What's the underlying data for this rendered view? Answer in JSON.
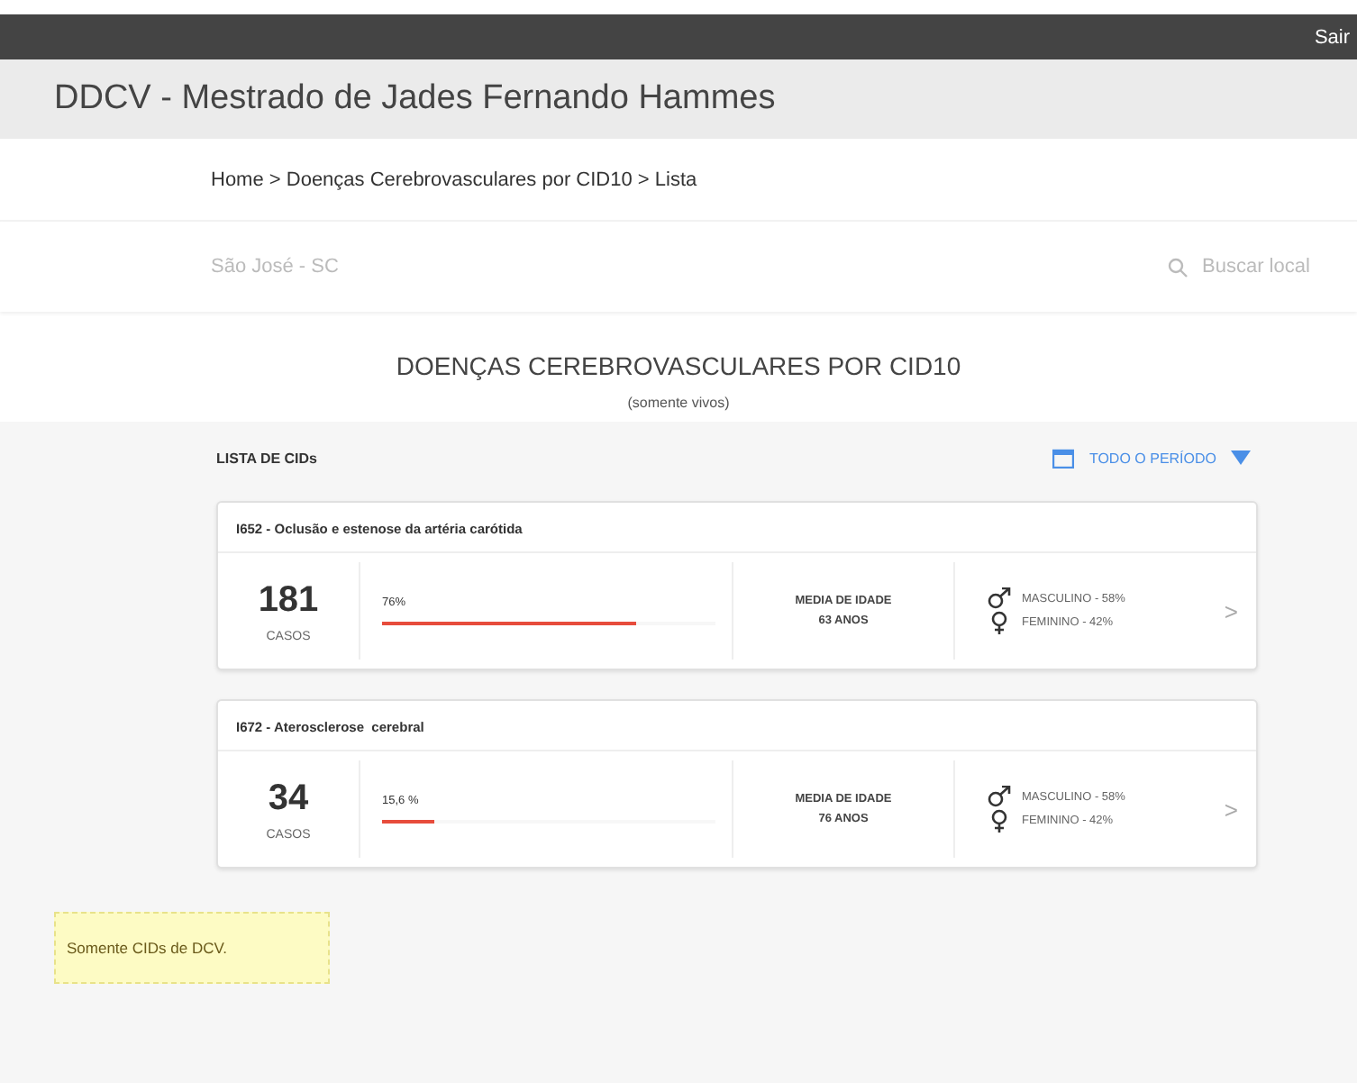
{
  "top_bar": {
    "logout": "Sair"
  },
  "header": {
    "title": "DDCV - Mestrado de Jades Fernando Hammes"
  },
  "breadcrumb": "Home > Doenças Cerebrovasculares por CID10 > Lista",
  "location": {
    "value": "São José - SC",
    "search_placeholder": "Buscar local"
  },
  "page_title": "DOENÇAS CEREBROVASCULARES POR CID10",
  "page_subtitle": "(somente vivos)",
  "list": {
    "heading": "LISTA DE CIDs",
    "period": "TODO O PERÍODO",
    "cards": [
      {
        "title": "I652 - Oclusão e estenose da artéria carótida",
        "count": "181",
        "count_label": "CASOS",
        "percent": "76%",
        "level": 0.76,
        "age_label": "MEDIA DE IDADE",
        "age": "63 ANOS",
        "male": "MASCULINO - 58%",
        "female": "FEMININO - 42%",
        "chevron": ">"
      },
      {
        "title": "I672 - Aterosclerose  cerebral",
        "count": "34",
        "count_label": "CASOS",
        "percent": "15,6 %",
        "level": 0.156,
        "age_label": "MEDIA DE IDADE",
        "age": "76 ANOS",
        "male": "MASCULINO - 58%",
        "female": "FEMININO - 42%",
        "chevron": ">"
      }
    ]
  },
  "note": "Somente CIDs de DCV."
}
